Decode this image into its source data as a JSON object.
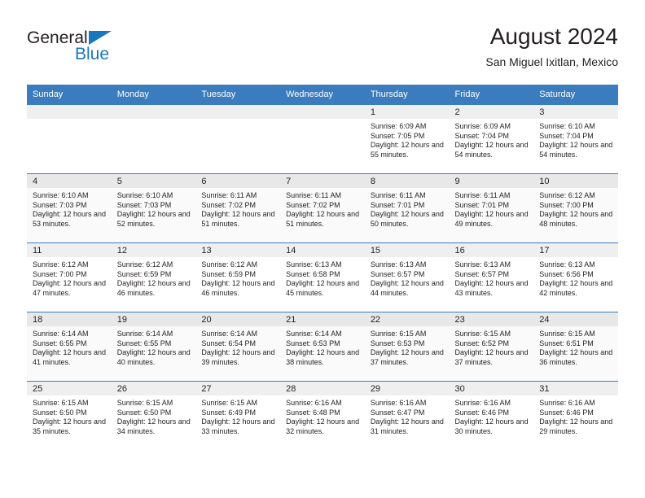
{
  "logo": {
    "line1": "General",
    "line2": "Blue",
    "triangle_color": "#1878be"
  },
  "header": {
    "title": "August 2024",
    "subtitle": "San Miguel Ixitlan, Mexico"
  },
  "theme": {
    "header_bg": "#3a7cbe",
    "header_text": "#ffffff",
    "daynum_band": "#efefef",
    "row_shaded": "#fafafa",
    "text": "#231f20"
  },
  "weekdays": [
    "Sunday",
    "Monday",
    "Tuesday",
    "Wednesday",
    "Thursday",
    "Friday",
    "Saturday"
  ],
  "labels": {
    "sunrise_prefix": "Sunrise:",
    "sunset_prefix": "Sunset:",
    "daylight_prefix": "Daylight:"
  },
  "weeks": [
    {
      "shaded": false,
      "days": [
        {
          "day": "",
          "empty": true
        },
        {
          "day": "",
          "empty": true
        },
        {
          "day": "",
          "empty": true
        },
        {
          "day": "",
          "empty": true
        },
        {
          "day": "1",
          "sunrise": "Sunrise: 6:09 AM",
          "sunset": "Sunset: 7:05 PM",
          "daylight": "Daylight: 12 hours and 55 minutes."
        },
        {
          "day": "2",
          "sunrise": "Sunrise: 6:09 AM",
          "sunset": "Sunset: 7:04 PM",
          "daylight": "Daylight: 12 hours and 54 minutes."
        },
        {
          "day": "3",
          "sunrise": "Sunrise: 6:10 AM",
          "sunset": "Sunset: 7:04 PM",
          "daylight": "Daylight: 12 hours and 54 minutes."
        }
      ]
    },
    {
      "shaded": true,
      "days": [
        {
          "day": "4",
          "sunrise": "Sunrise: 6:10 AM",
          "sunset": "Sunset: 7:03 PM",
          "daylight": "Daylight: 12 hours and 53 minutes."
        },
        {
          "day": "5",
          "sunrise": "Sunrise: 6:10 AM",
          "sunset": "Sunset: 7:03 PM",
          "daylight": "Daylight: 12 hours and 52 minutes."
        },
        {
          "day": "6",
          "sunrise": "Sunrise: 6:11 AM",
          "sunset": "Sunset: 7:02 PM",
          "daylight": "Daylight: 12 hours and 51 minutes."
        },
        {
          "day": "7",
          "sunrise": "Sunrise: 6:11 AM",
          "sunset": "Sunset: 7:02 PM",
          "daylight": "Daylight: 12 hours and 51 minutes."
        },
        {
          "day": "8",
          "sunrise": "Sunrise: 6:11 AM",
          "sunset": "Sunset: 7:01 PM",
          "daylight": "Daylight: 12 hours and 50 minutes."
        },
        {
          "day": "9",
          "sunrise": "Sunrise: 6:11 AM",
          "sunset": "Sunset: 7:01 PM",
          "daylight": "Daylight: 12 hours and 49 minutes."
        },
        {
          "day": "10",
          "sunrise": "Sunrise: 6:12 AM",
          "sunset": "Sunset: 7:00 PM",
          "daylight": "Daylight: 12 hours and 48 minutes."
        }
      ]
    },
    {
      "shaded": false,
      "days": [
        {
          "day": "11",
          "sunrise": "Sunrise: 6:12 AM",
          "sunset": "Sunset: 7:00 PM",
          "daylight": "Daylight: 12 hours and 47 minutes."
        },
        {
          "day": "12",
          "sunrise": "Sunrise: 6:12 AM",
          "sunset": "Sunset: 6:59 PM",
          "daylight": "Daylight: 12 hours and 46 minutes."
        },
        {
          "day": "13",
          "sunrise": "Sunrise: 6:12 AM",
          "sunset": "Sunset: 6:59 PM",
          "daylight": "Daylight: 12 hours and 46 minutes."
        },
        {
          "day": "14",
          "sunrise": "Sunrise: 6:13 AM",
          "sunset": "Sunset: 6:58 PM",
          "daylight": "Daylight: 12 hours and 45 minutes."
        },
        {
          "day": "15",
          "sunrise": "Sunrise: 6:13 AM",
          "sunset": "Sunset: 6:57 PM",
          "daylight": "Daylight: 12 hours and 44 minutes."
        },
        {
          "day": "16",
          "sunrise": "Sunrise: 6:13 AM",
          "sunset": "Sunset: 6:57 PM",
          "daylight": "Daylight: 12 hours and 43 minutes."
        },
        {
          "day": "17",
          "sunrise": "Sunrise: 6:13 AM",
          "sunset": "Sunset: 6:56 PM",
          "daylight": "Daylight: 12 hours and 42 minutes."
        }
      ]
    },
    {
      "shaded": true,
      "days": [
        {
          "day": "18",
          "sunrise": "Sunrise: 6:14 AM",
          "sunset": "Sunset: 6:55 PM",
          "daylight": "Daylight: 12 hours and 41 minutes."
        },
        {
          "day": "19",
          "sunrise": "Sunrise: 6:14 AM",
          "sunset": "Sunset: 6:55 PM",
          "daylight": "Daylight: 12 hours and 40 minutes."
        },
        {
          "day": "20",
          "sunrise": "Sunrise: 6:14 AM",
          "sunset": "Sunset: 6:54 PM",
          "daylight": "Daylight: 12 hours and 39 minutes."
        },
        {
          "day": "21",
          "sunrise": "Sunrise: 6:14 AM",
          "sunset": "Sunset: 6:53 PM",
          "daylight": "Daylight: 12 hours and 38 minutes."
        },
        {
          "day": "22",
          "sunrise": "Sunrise: 6:15 AM",
          "sunset": "Sunset: 6:53 PM",
          "daylight": "Daylight: 12 hours and 37 minutes."
        },
        {
          "day": "23",
          "sunrise": "Sunrise: 6:15 AM",
          "sunset": "Sunset: 6:52 PM",
          "daylight": "Daylight: 12 hours and 37 minutes."
        },
        {
          "day": "24",
          "sunrise": "Sunrise: 6:15 AM",
          "sunset": "Sunset: 6:51 PM",
          "daylight": "Daylight: 12 hours and 36 minutes."
        }
      ]
    },
    {
      "shaded": false,
      "days": [
        {
          "day": "25",
          "sunrise": "Sunrise: 6:15 AM",
          "sunset": "Sunset: 6:50 PM",
          "daylight": "Daylight: 12 hours and 35 minutes."
        },
        {
          "day": "26",
          "sunrise": "Sunrise: 6:15 AM",
          "sunset": "Sunset: 6:50 PM",
          "daylight": "Daylight: 12 hours and 34 minutes."
        },
        {
          "day": "27",
          "sunrise": "Sunrise: 6:15 AM",
          "sunset": "Sunset: 6:49 PM",
          "daylight": "Daylight: 12 hours and 33 minutes."
        },
        {
          "day": "28",
          "sunrise": "Sunrise: 6:16 AM",
          "sunset": "Sunset: 6:48 PM",
          "daylight": "Daylight: 12 hours and 32 minutes."
        },
        {
          "day": "29",
          "sunrise": "Sunrise: 6:16 AM",
          "sunset": "Sunset: 6:47 PM",
          "daylight": "Daylight: 12 hours and 31 minutes."
        },
        {
          "day": "30",
          "sunrise": "Sunrise: 6:16 AM",
          "sunset": "Sunset: 6:46 PM",
          "daylight": "Daylight: 12 hours and 30 minutes."
        },
        {
          "day": "31",
          "sunrise": "Sunrise: 6:16 AM",
          "sunset": "Sunset: 6:46 PM",
          "daylight": "Daylight: 12 hours and 29 minutes."
        }
      ]
    }
  ]
}
